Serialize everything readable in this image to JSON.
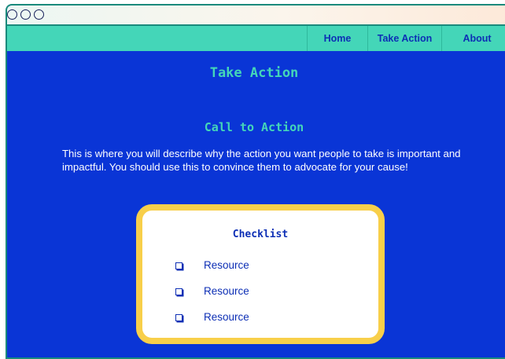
{
  "nav": {
    "items": [
      {
        "label": "Home"
      },
      {
        "label": "Take Action"
      },
      {
        "label": "About"
      }
    ]
  },
  "page": {
    "title": "Take Action"
  },
  "call_to_action": {
    "title": "Call to Action",
    "description": "This is where you will describe why the action you want people to take is important and impactful. You should use this to convince them to advocate for your cause!"
  },
  "checklist": {
    "title": "Checklist",
    "items": [
      {
        "label": "Resource"
      },
      {
        "label": "Resource"
      },
      {
        "label": "Resource"
      }
    ]
  },
  "colors": {
    "background": "#0a35d6",
    "nav_background": "#44d6b8",
    "accent_teal": "#44d6b8",
    "card_border": "#f8cf4a",
    "text_blue": "#0d2fb5"
  }
}
